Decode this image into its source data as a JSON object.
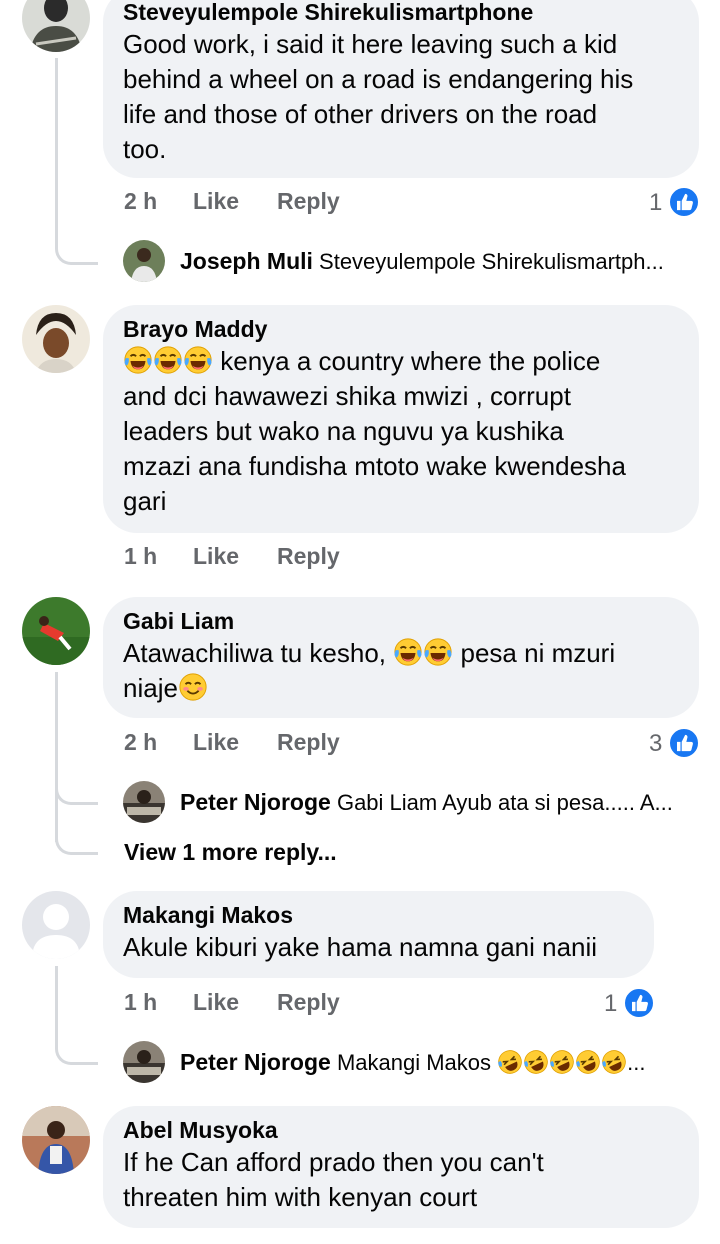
{
  "comments": [
    {
      "name": "Steveyulempole Shirekulismartphone",
      "lines": [
        "Good work, i said it here leaving such a kid",
        "behind a wheel on a road is endangering his",
        "life and those of other drivers on the road",
        "too."
      ],
      "time": "2 h",
      "like": "Like",
      "reply": "Reply",
      "reactions": "1",
      "replies": [
        {
          "name": "Joseph Muli",
          "text": "Steveyulempole Shirekulismartph..."
        }
      ]
    },
    {
      "name": "Brayo Maddy",
      "first_line_text": "kenya a country where the police",
      "lines": [
        "and dci hawawezi shika mwizi , corrupt",
        "leaders but wako  na nguvu  ya kushika",
        "mzazi  ana fundisha mtoto wake kwendesha",
        "gari"
      ],
      "time": "1 h",
      "like": "Like",
      "reply": "Reply"
    },
    {
      "name": "Gabi Liam",
      "line1_pre": "Atawachiliwa tu kesho,",
      "line1_post": "pesa ni mzuri",
      "line2": "niaje",
      "time": "2 h",
      "like": "Like",
      "reply": "Reply",
      "reactions": "3",
      "replies": [
        {
          "name": "Peter Njoroge",
          "text": "Gabi Liam Ayub ata si pesa..... A..."
        }
      ],
      "more_replies": "View 1 more reply..."
    },
    {
      "name": "Makangi Makos",
      "lines": [
        "Akule kiburi yake hama namna gani nanii"
      ],
      "time": "1 h",
      "like": "Like",
      "reply": "Reply",
      "reactions": "1",
      "replies": [
        {
          "name": "Peter Njoroge",
          "text": "Makangi Makos",
          "suffix": "..."
        }
      ]
    },
    {
      "name": "Abel Musyoka",
      "lines": [
        "If he Can afford prado then you can't",
        "threaten him with kenyan court"
      ]
    }
  ],
  "colors": {
    "bubble": "#f0f2f5",
    "meta": "#65676b",
    "like_badge": "#1877f2",
    "thread": "#d6d9dd"
  }
}
